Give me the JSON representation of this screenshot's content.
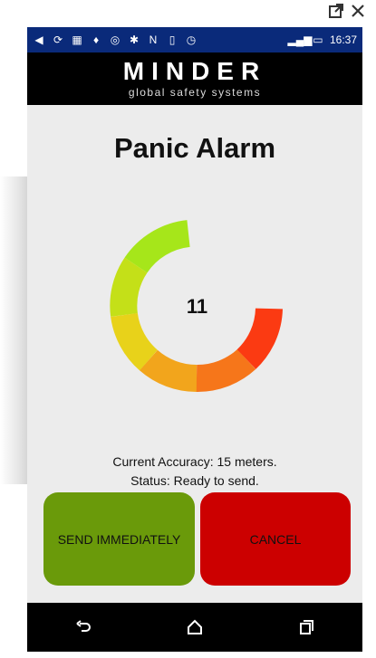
{
  "window": {
    "popout_icon": "external-window-icon",
    "close_icon": "close-icon"
  },
  "statusbar": {
    "time": "16:37",
    "icons": [
      "back-arrow-icon",
      "sync-icon",
      "image-icon",
      "twitter-icon",
      "nfc-icon",
      "bluetooth-icon",
      "n-icon",
      "vibrate-icon",
      "alarm-icon",
      "signal-icon",
      "battery-icon"
    ]
  },
  "header": {
    "brand": "MINDER",
    "tagline": "global safety systems"
  },
  "main": {
    "title": "Panic Alarm",
    "gauge_value": "11",
    "accuracy_text": "Current Accuracy: 15 meters.",
    "status_text": "Status: Ready to send.",
    "send_label": "SEND IMMEDIATELY",
    "cancel_label": "CANCEL"
  },
  "colors": {
    "statusbar": "#0a2a7a",
    "send_button": "#6a9a0a",
    "cancel_button": "#cc0000",
    "gauge_start": "#99e61a",
    "gauge_end": "#ff1a00"
  },
  "navbar": {
    "icons": [
      "back-icon",
      "home-icon",
      "recents-icon"
    ]
  }
}
